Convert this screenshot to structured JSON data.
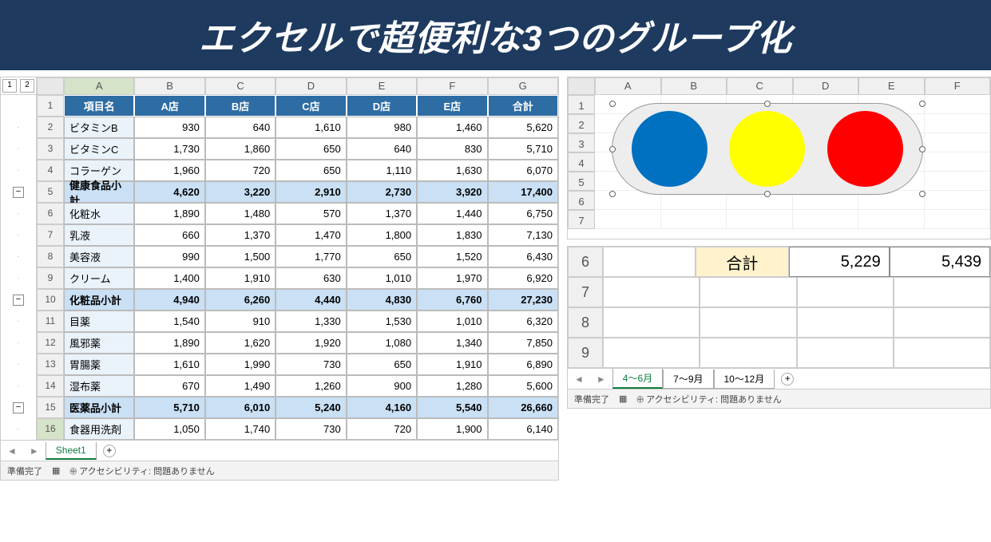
{
  "banner": "エクセルで超便利な3つのグループ化",
  "main": {
    "outline_levels": [
      "1",
      "2"
    ],
    "cols": [
      "A",
      "B",
      "C",
      "D",
      "E",
      "F",
      "G"
    ],
    "header": [
      "項目名",
      "A店",
      "B店",
      "C店",
      "D店",
      "E店",
      "合計"
    ],
    "rows": [
      {
        "n": "2",
        "type": "d",
        "c": [
          "ビタミンB",
          "930",
          "640",
          "1,610",
          "980",
          "1,460",
          "5,620"
        ]
      },
      {
        "n": "3",
        "type": "d",
        "c": [
          "ビタミンC",
          "1,730",
          "1,860",
          "650",
          "640",
          "830",
          "5,710"
        ]
      },
      {
        "n": "4",
        "type": "d",
        "c": [
          "コラーゲン",
          "1,960",
          "720",
          "650",
          "1,110",
          "1,630",
          "6,070"
        ]
      },
      {
        "n": "5",
        "type": "s",
        "c": [
          "健康食品小計",
          "4,620",
          "3,220",
          "2,910",
          "2,730",
          "3,920",
          "17,400"
        ]
      },
      {
        "n": "6",
        "type": "d",
        "c": [
          "化粧水",
          "1,890",
          "1,480",
          "570",
          "1,370",
          "1,440",
          "6,750"
        ]
      },
      {
        "n": "7",
        "type": "d",
        "c": [
          "乳液",
          "660",
          "1,370",
          "1,470",
          "1,800",
          "1,830",
          "7,130"
        ]
      },
      {
        "n": "8",
        "type": "d",
        "c": [
          "美容液",
          "990",
          "1,500",
          "1,770",
          "650",
          "1,520",
          "6,430"
        ]
      },
      {
        "n": "9",
        "type": "d",
        "c": [
          "クリーム",
          "1,400",
          "1,910",
          "630",
          "1,010",
          "1,970",
          "6,920"
        ]
      },
      {
        "n": "10",
        "type": "s",
        "c": [
          "化粧品小計",
          "4,940",
          "6,260",
          "4,440",
          "4,830",
          "6,760",
          "27,230"
        ]
      },
      {
        "n": "11",
        "type": "d",
        "c": [
          "目薬",
          "1,540",
          "910",
          "1,330",
          "1,530",
          "1,010",
          "6,320"
        ]
      },
      {
        "n": "12",
        "type": "d",
        "c": [
          "風邪薬",
          "1,890",
          "1,620",
          "1,920",
          "1,080",
          "1,340",
          "7,850"
        ]
      },
      {
        "n": "13",
        "type": "d",
        "c": [
          "胃腸薬",
          "1,610",
          "1,990",
          "730",
          "650",
          "1,910",
          "6,890"
        ]
      },
      {
        "n": "14",
        "type": "d",
        "c": [
          "湿布薬",
          "670",
          "1,490",
          "1,260",
          "900",
          "1,280",
          "5,600"
        ]
      },
      {
        "n": "15",
        "type": "s",
        "c": [
          "医薬品小計",
          "5,710",
          "6,010",
          "5,240",
          "4,160",
          "5,540",
          "26,660"
        ]
      },
      {
        "n": "16",
        "type": "d",
        "sel": true,
        "c": [
          "食器用洗剤",
          "1,050",
          "1,740",
          "730",
          "720",
          "1,900",
          "6,140"
        ]
      }
    ],
    "tabs": [
      "Sheet1"
    ],
    "status_ready": "準備完了",
    "status_acc": "アクセシビリティ: 問題ありません"
  },
  "shapes": {
    "cols": [
      "A",
      "B",
      "C",
      "D",
      "E",
      "F"
    ],
    "row_count": 7,
    "circles": [
      "#0070c0",
      "#ffff00",
      "#ff0000"
    ]
  },
  "summary": {
    "rows": [
      "6",
      "7",
      "8",
      "9"
    ],
    "label": "合計",
    "vals": [
      "5,229",
      "5,439"
    ],
    "tabs": [
      "4～6月",
      "7～9月",
      "10～12月"
    ],
    "status_ready": "準備完了",
    "status_acc": "アクセシビリティ: 問題ありません"
  }
}
